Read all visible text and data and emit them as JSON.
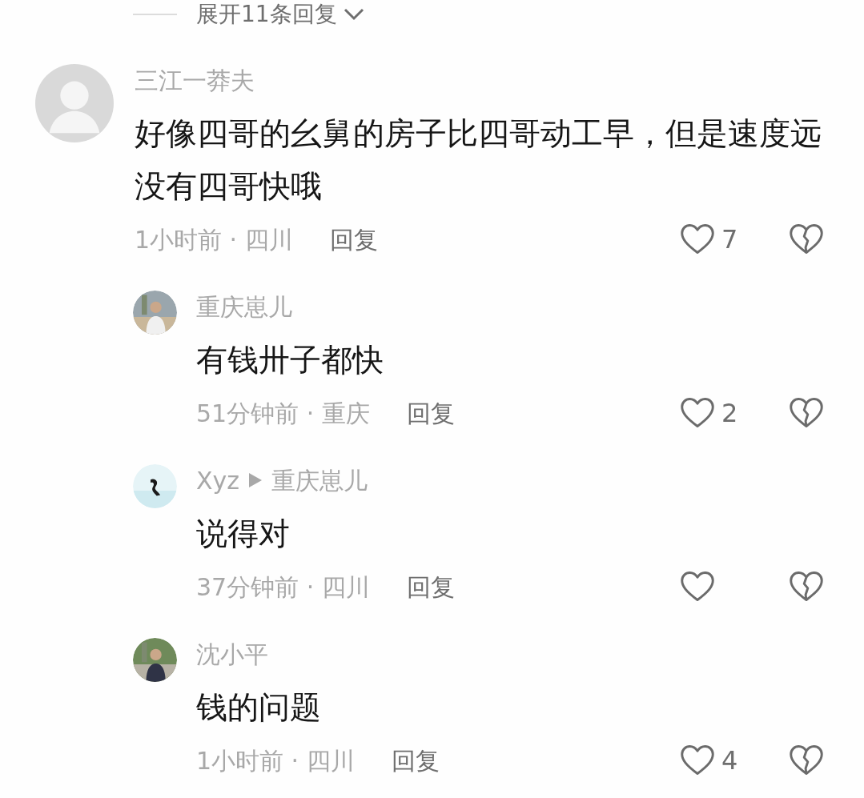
{
  "expand_replies": {
    "label": "展开11条回复"
  },
  "comments": [
    {
      "kind": "top",
      "name": "三江一莽夫",
      "text": "好像四哥的幺舅的房子比四哥动工早，但是速度远没有四哥快哦",
      "meta": "1小时前 · 四川",
      "reply": "回复",
      "likes": "7"
    },
    {
      "kind": "reply",
      "name": "重庆崽儿",
      "text": "有钱卅子都快",
      "meta": "51分钟前 · 重庆",
      "reply": "回复",
      "likes": "2"
    },
    {
      "kind": "reply",
      "name": "Xyz",
      "reply_to": "重庆崽儿",
      "text": "说得对",
      "meta": "37分钟前 · 四川",
      "reply": "回复"
    },
    {
      "kind": "reply",
      "name": "沈小平",
      "text": "钱的问题",
      "meta": "1小时前 · 四川",
      "reply": "回复",
      "likes": "4"
    }
  ]
}
